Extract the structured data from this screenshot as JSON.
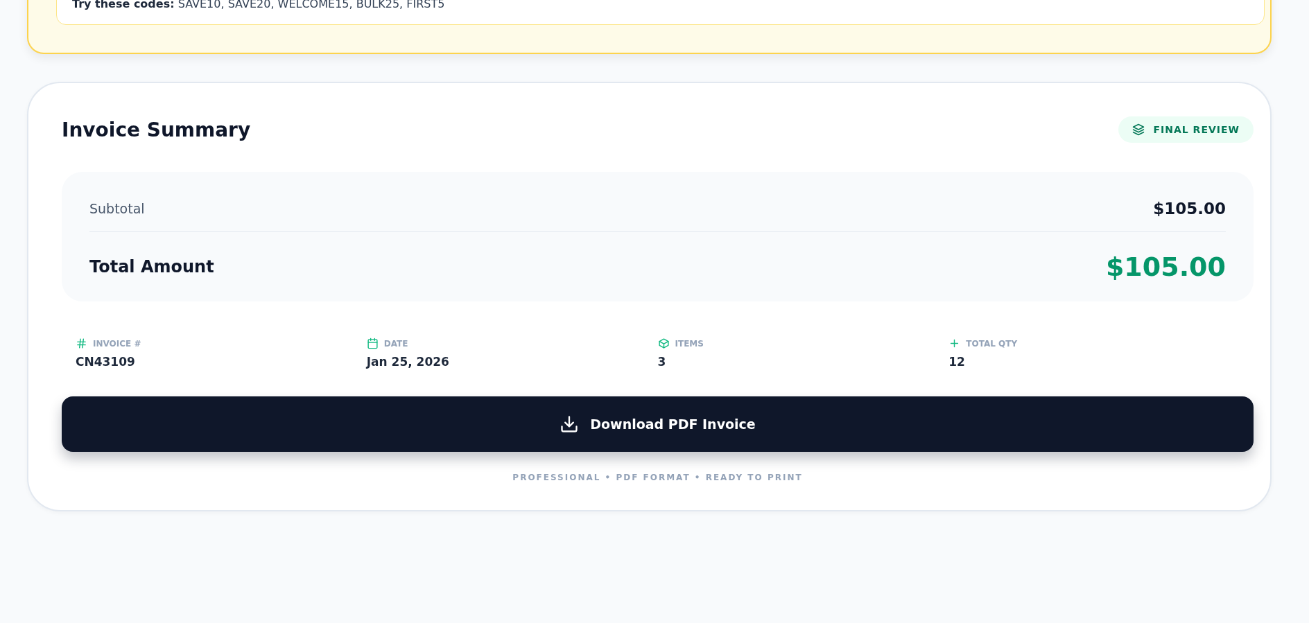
{
  "promo": {
    "text": "**Try these codes:** SAVE10, SAVE20, WELCOME15, BULK25, FIRST5"
  },
  "summary": {
    "title": "Invoice Summary",
    "badge": "FINAL REVIEW",
    "rows": [
      {
        "kind": "subtotal",
        "label": "Subtotal",
        "value": "$105.00"
      },
      {
        "kind": "total",
        "label": "Total Amount",
        "value": "$105.00"
      }
    ],
    "details": [
      {
        "kind": "hash",
        "label": "INVOICE #",
        "value": "CN43109"
      },
      {
        "kind": "calendar",
        "label": "DATE",
        "value": "Jan 25, 2026"
      },
      {
        "kind": "box",
        "label": "ITEMS",
        "value": "3"
      },
      {
        "kind": "plus",
        "label": "TOTAL QTY",
        "value": "12"
      }
    ],
    "download_button": "Download PDF Invoice",
    "footer": "PROFESSIONAL • PDF FORMAT • READY TO PRINT"
  }
}
